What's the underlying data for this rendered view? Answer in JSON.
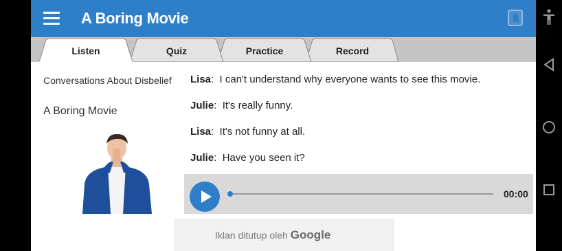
{
  "header": {
    "title": "A Boring Movie",
    "menu_icon": "hamburger-menu-icon",
    "book_icon": "book-icon"
  },
  "tabs": [
    {
      "label": "Listen",
      "active": true
    },
    {
      "label": "Quiz",
      "active": false
    },
    {
      "label": "Practice",
      "active": false
    },
    {
      "label": "Record",
      "active": false
    }
  ],
  "sidebar": {
    "subtitle": "Conversations About Disbelief",
    "title": "A Boring Movie",
    "image": "surprised-man-illustration"
  },
  "dialogue": [
    {
      "speaker": "Lisa",
      "text": "I can't understand why everyone wants to see this movie."
    },
    {
      "speaker": "Julie",
      "text": "It's really funny."
    },
    {
      "speaker": "Lisa",
      "text": "It's not funny at all."
    },
    {
      "speaker": "Julie",
      "text": "Have you seen it?"
    }
  ],
  "player": {
    "time": "00:00",
    "progress": 0
  },
  "ad": {
    "text": "Iklan ditutup oleh",
    "brand": "Google"
  },
  "system_nav": {
    "icons": [
      "accessibility-icon",
      "back-icon",
      "home-icon",
      "recents-icon"
    ]
  },
  "colors": {
    "primary": "#2f7fc8",
    "tab_strip": "#c5c5c5",
    "player_bg": "#d9d9d9"
  }
}
